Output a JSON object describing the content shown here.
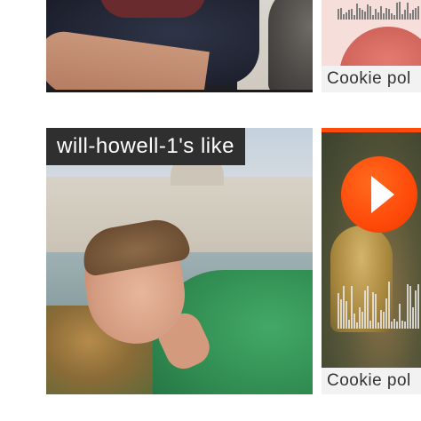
{
  "tiles": {
    "like_label": "will-howell-1's like",
    "cookie_policy_top": "Cookie pol",
    "cookie_policy_bottom": "Cookie pol"
  },
  "icons": {
    "play": "play-icon"
  },
  "colors": {
    "accent": "#ff4a0a",
    "label_bg": "#2f2f2f",
    "cookie_bg": "#f2f2f2"
  }
}
